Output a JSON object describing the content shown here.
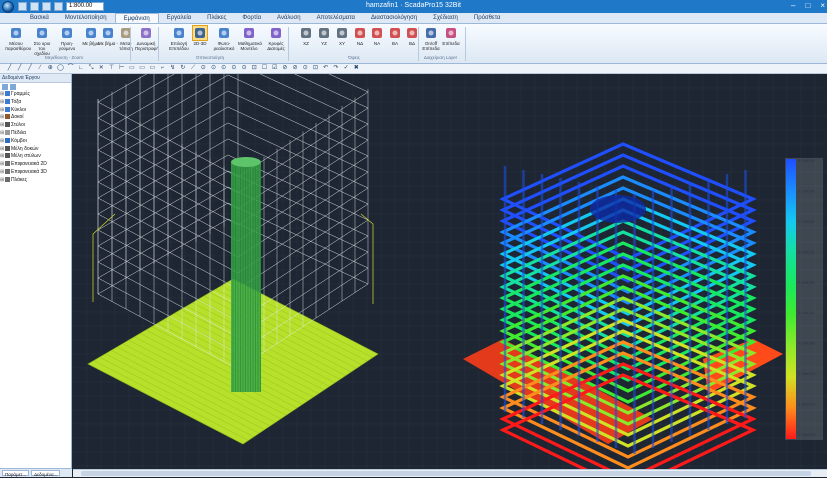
{
  "window": {
    "title": "hamzafin1 · ScadaPro15 32Bit",
    "scale": "1:800.00",
    "min": "–",
    "max": "□",
    "close": "×"
  },
  "tabs": [
    "Βασικά",
    "Μοντελοποίηση",
    "Εμφάνιση",
    "Εργαλεία",
    "Πλάκες",
    "Φορτία",
    "Ανάλυση",
    "Αποτελέσματα",
    "Διαστασιολόγηση",
    "Σχέδιαση",
    "Πρόσθετα"
  ],
  "active_tab": "Εμφάνιση",
  "ribbon": {
    "buttons": [
      {
        "label": "Μέσου παρασθύρου",
        "icon": "zoom-window-icon",
        "color": "#2a6ec7"
      },
      {
        "label": "Στο οριο του σχεδίου",
        "icon": "zoom-extents-icon",
        "color": "#2a6ec7"
      },
      {
        "label": "Προη-γούμενο",
        "icon": "zoom-previous-icon",
        "color": "#2a6ec7"
      },
      {
        "label": "Με βήμα",
        "icon": "zoom-step-in-icon",
        "color": "#2a6ec7"
      },
      {
        "label": "Με βήμα -",
        "icon": "zoom-step-out-icon",
        "color": "#2a6ec7"
      },
      {
        "label": "Μετα-τόπιση",
        "icon": "pan-hand-icon",
        "color": "#9a8b6a"
      },
      {
        "label": "Δυναμική Περιστροφή",
        "icon": "dynamic-rotate-icon",
        "color": "#7b5bbf"
      },
      {
        "label": "Επιλογή Επιπέδου",
        "icon": "plane-select-icon",
        "color": "#2a6ec7"
      },
      {
        "label": "2D-3D",
        "icon": "view-2d3d-icon",
        "color": "#1d4f93"
      },
      {
        "label": "Φωτο-ρεαλιστικό",
        "icon": "photorealistic-eye-icon",
        "color": "#2a6ec7"
      },
      {
        "label": "Μαθηματικό Μοντέλο",
        "icon": "math-model-icon",
        "color": "#6d48c3"
      },
      {
        "label": "Κρυφές Διατομές",
        "icon": "hidden-sections-icon",
        "color": "#6d48c3"
      },
      {
        "label": "XZ",
        "icon": "view-xz-icon",
        "color": "#4a5a6b"
      },
      {
        "label": "YZ",
        "icon": "view-yz-icon",
        "color": "#4a5a6b"
      },
      {
        "label": "XY",
        "icon": "view-xy-icon",
        "color": "#4a5a6b"
      },
      {
        "label": "ΝΔ",
        "icon": "view-sw-icon",
        "color": "#c33"
      },
      {
        "label": "ΝΑ",
        "icon": "view-se-icon",
        "color": "#c33"
      },
      {
        "label": "ΒΑ",
        "icon": "view-ne-icon",
        "color": "#c33"
      },
      {
        "label": "ΒΔ",
        "icon": "view-nw-icon",
        "color": "#c33"
      },
      {
        "label": "On/off Επίπεδα",
        "icon": "layers-onoff-icon",
        "color": "#27559c"
      },
      {
        "label": "Επίπεδα",
        "icon": "layers-icon",
        "color": "#c0306d"
      }
    ],
    "groups": [
      "Μεγέθυνση - Zoom",
      "Οπτικοποίηση",
      "Όψεις",
      "Διαχείριση Layer"
    ]
  },
  "panel": {
    "title": "Δεδομένα Έργου",
    "tree": [
      {
        "label": "Γραμμές",
        "icon_color": "#3a7bd5"
      },
      {
        "label": "Τόξα",
        "icon_color": "#3a7bd5"
      },
      {
        "label": "Κύκλοι",
        "icon_color": "#3a7bd5"
      },
      {
        "label": "Δοκοί",
        "icon_color": "#8c5a2b"
      },
      {
        "label": "Στύλοι",
        "icon_color": "#555"
      },
      {
        "label": "Πέδιλα",
        "icon_color": "#999"
      },
      {
        "label": "Κόμβοι",
        "icon_color": "#2a6ec7"
      },
      {
        "label": "Μέλη δοκών",
        "icon_color": "#555"
      },
      {
        "label": "Μέλη στύλων",
        "icon_color": "#555"
      },
      {
        "label": "Επιφανειακά 2D",
        "icon_color": "#6b6b6b"
      },
      {
        "label": "Επιφανειακά 3D",
        "icon_color": "#6b6b6b"
      },
      {
        "label": "Πλάκες",
        "icon_color": "#6b6b6b"
      }
    ],
    "bottom_tabs": [
      "Παράμετ...",
      "Δεδομένα..."
    ]
  },
  "legend": {
    "values": [
      "0.000334",
      "0.000298",
      "0.000262",
      "0.000216",
      "0.000180",
      "0.000144",
      "0.000108",
      "7.20e-005",
      "3.60e-005",
      "1.34e-010"
    ],
    "colors": [
      "#1f4fff",
      "#1a8cff",
      "#14c8f0",
      "#14e0a0",
      "#18e860",
      "#40ea30",
      "#8ce82a",
      "#d0e224",
      "#ff8c1c",
      "#ff1a1a"
    ]
  }
}
